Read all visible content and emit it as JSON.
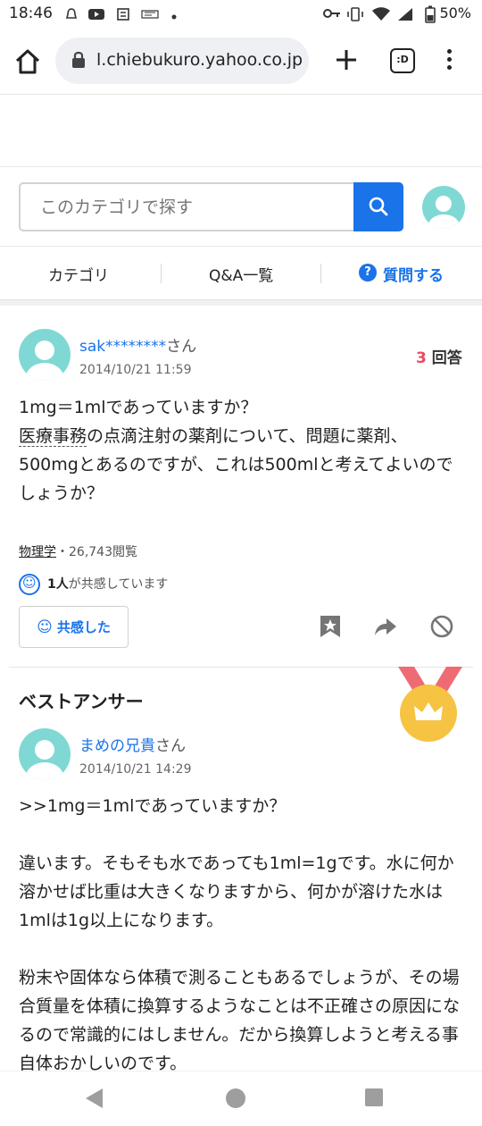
{
  "status_bar": {
    "time": "18:46",
    "battery": "50%",
    "left_icons": [
      "notification-icon",
      "youtube-icon",
      "app-icon",
      "news-icon",
      "dot-icon"
    ],
    "right_icons": [
      "key-icon",
      "vibrate-icon",
      "wifi-icon",
      "signal-icon",
      "battery-icon"
    ]
  },
  "browser": {
    "url": "l.chiebukuro.yahoo.co.jp",
    "tabs_label": ":D"
  },
  "search": {
    "placeholder": "このカテゴリで探す"
  },
  "nav": {
    "category": "カテゴリ",
    "qa_list": "Q&A一覧",
    "ask": "質問する"
  },
  "question": {
    "user": "sak********",
    "honorific": "さん",
    "date": "2014/10/21 11:59",
    "answers_count": "3",
    "answers_label": "回答",
    "line1": "1mg＝1mlであっていますか？",
    "keyword": "医療事務",
    "line2_rest": "の点滴注射の薬剤について、問題に薬剤、500mgとあるのですが、これは500mlと考えてよいのでしょうか？",
    "category": "物理学",
    "views": "・26,743閲覧",
    "empathy_count": "1人",
    "empathy_text": "が共感しています",
    "empathy_button": "共感した"
  },
  "best_answer": {
    "title": "ベストアンサー",
    "user": "まめの兄貴",
    "honorific": "さん",
    "date": "2014/10/21 14:29",
    "p1": ">>1mg＝1mlであっていますか？",
    "p2": "違います。そもそも水であっても1ml=1gです。水に何か溶かせば比重は大きくなりますから、何かが溶けた水は1mlは1g以上になります。",
    "p3": "粉末や固体なら体積で測ることもあるでしょうが、その場合質量を体積に換算するようなことは不正確さの原因になるので常識的にはしません。だから換算しようと考える事自体おかしいのです。"
  },
  "colors": {
    "accent": "#1a73e8",
    "avatar": "#80d8d4",
    "answer_count": "#e84a5f",
    "medal": "#f6c343",
    "ribbon": "#ef6b74"
  }
}
